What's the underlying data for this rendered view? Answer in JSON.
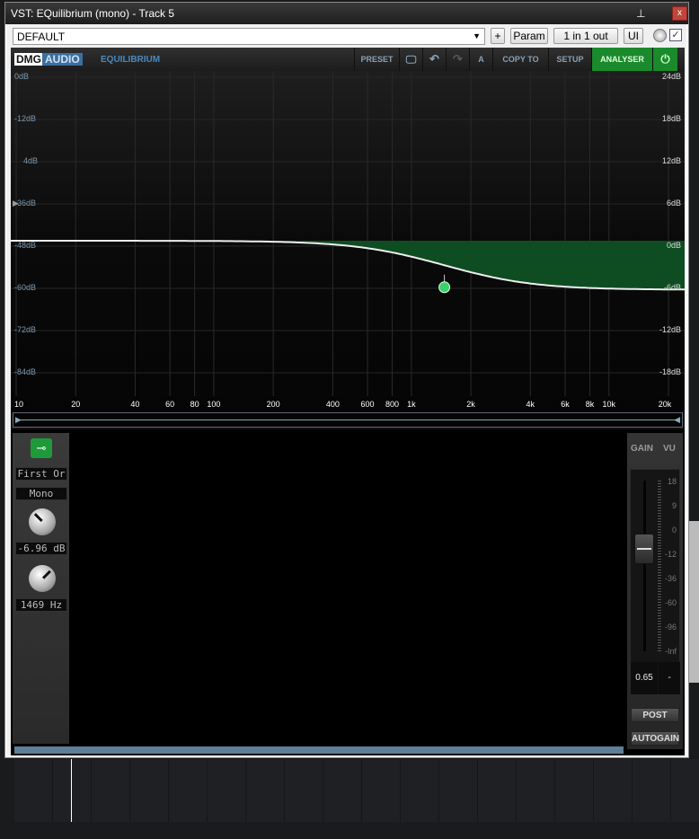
{
  "window": {
    "title": "VST: EQuilibrium (mono) - Track 5",
    "pin_icon": "pin-icon",
    "close_label": "x"
  },
  "toolbar": {
    "preset": "DEFAULT",
    "add": "+",
    "param": "Param",
    "io": "1 in 1 out",
    "ui": "UI",
    "bypass_checked": "✓"
  },
  "header": {
    "dmg": "DMG",
    "audio": "AUDIO",
    "product": "EQUILIBRIUM",
    "buttons": [
      "PRESET",
      "",
      "",
      "",
      "A",
      "COPY TO",
      "SETUP",
      "ANALYSER",
      ""
    ],
    "accent": "#1a8a2c"
  },
  "graph": {
    "left_labels": [
      "0dB",
      "-12dB",
      "4dB",
      "-36dB",
      "-48dB",
      "-60dB",
      "-72dB",
      "-84dB"
    ],
    "right_labels": [
      "24dB",
      "18dB",
      "12dB",
      "6dB",
      "0dB",
      "-6dB",
      "-12dB",
      "-18dB"
    ],
    "freq_labels": [
      "10",
      "20",
      "40",
      "60",
      "80",
      "100",
      "200",
      "400",
      "600",
      "800",
      "1k",
      "2k",
      "4k",
      "6k",
      "8k",
      "10k",
      "20k"
    ],
    "freq_values": [
      10,
      20,
      40,
      60,
      80,
      100,
      200,
      400,
      600,
      800,
      1000,
      2000,
      4000,
      6000,
      8000,
      10000,
      20000
    ]
  },
  "band": {
    "type": "First Or",
    "channel": "Mono",
    "gain": "-6.96 dB",
    "freq": "1469 Hz",
    "gain_db": -6.96,
    "freq_hz": 1469
  },
  "gain_panel": {
    "gain": "GAIN",
    "vu": "VU",
    "scale": [
      "18",
      "9",
      "0",
      "-12",
      "-36",
      "-60",
      "-96",
      "-Inf"
    ],
    "value": "0.65",
    "vu_value": "-",
    "post": "POST",
    "autogain": "AUTOGAIN",
    "fader_level": 0.6
  }
}
